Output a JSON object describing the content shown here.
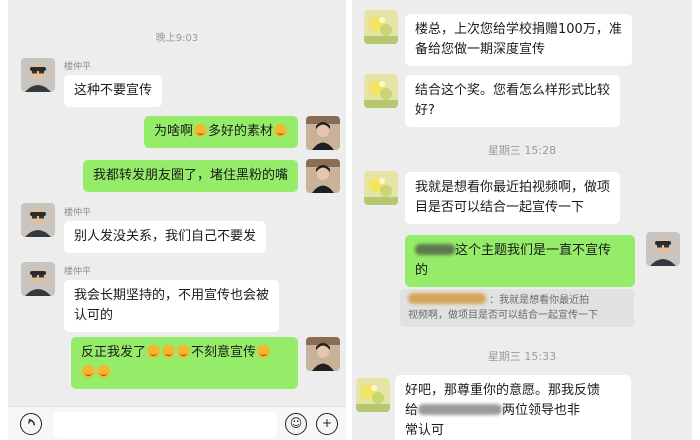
{
  "left_panel": {
    "timestamp": "晚上9:03",
    "sender_name": "楼仲平",
    "messages": [
      {
        "text": "这种不要宣传"
      },
      {
        "text_a": "为啥啊",
        "text_b": "多好的素材"
      },
      {
        "text": "我都转发朋友圈了，堵住黑粉的嘴"
      },
      {
        "text": "别人发没关系，我们自己不要发"
      },
      {
        "text_line1": "我会长期坚持的，不用宣传也会被",
        "text_line2": "认可的"
      },
      {
        "text_a": "反正我发了",
        "text_b": "不刻意宣传"
      }
    ],
    "toolbar": {
      "voice_icon": "voice-icon",
      "emoji_icon": "emoji-icon",
      "plus_icon": "plus-icon"
    }
  },
  "right_panel": {
    "messages": [
      {
        "line1": "楼总，上次您给学校捐赠100万，准",
        "line2": "备给您做一期深度宣传"
      },
      {
        "line1": "结合这个奖。您看怎么样形式比较",
        "line2": "好?"
      },
      {
        "line1": "我就是想看你最近拍视频啊，做项",
        "line2": "目是否可以结合一起宣传一下"
      },
      {
        "line1_tail": "这个主题我们是一直不宣传",
        "line2": "的"
      },
      {
        "line1_tail": "：我就是想看你最近拍",
        "line2": "视频啊，做项目是否可以结合一起宣传一下"
      },
      {
        "line1": "好吧，那尊重你的意愿。那我反馈",
        "line2_a": "给",
        "line2_b": "两位领导也非",
        "line3": "常认可"
      }
    ],
    "timestamps": [
      "星期三 15:28",
      "星期三 15:33"
    ]
  },
  "colors": {
    "chat_bg": "#ededed",
    "outgoing_bubble": "#95ec69",
    "incoming_bubble": "#ffffff"
  }
}
